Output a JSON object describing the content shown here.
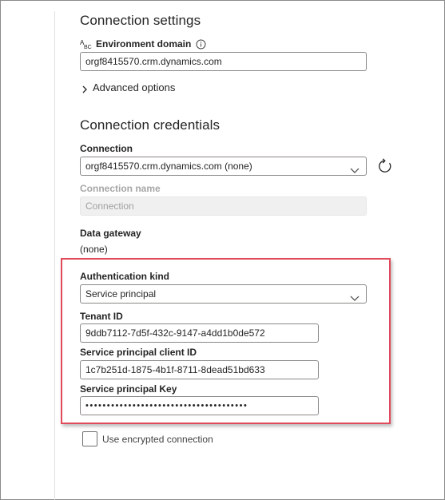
{
  "connection_settings": {
    "title": "Connection settings",
    "environment_domain_label": "Environment domain",
    "environment_domain_value": "orgf8415570.crm.dynamics.com",
    "advanced_options_label": "Advanced options"
  },
  "connection_credentials": {
    "title": "Connection credentials",
    "connection_label": "Connection",
    "connection_value": "orgf8415570.crm.dynamics.com (none)",
    "connection_name_label": "Connection name",
    "connection_name_placeholder": "Connection",
    "data_gateway_label": "Data gateway",
    "data_gateway_value": "(none)",
    "authentication_kind_label": "Authentication kind",
    "authentication_kind_value": "Service principal",
    "tenant_id_label": "Tenant ID",
    "tenant_id_value": "9ddb7112-7d5f-432c-9147-a4dd1b0de572",
    "client_id_label": "Service principal client ID",
    "client_id_value": "1c7b251d-1875-4b1f-8711-8dead51bd633",
    "key_label": "Service principal Key",
    "key_value": "••••••••••••••••••••••••••••••••••••••",
    "use_encrypted_label": "Use encrypted connection",
    "use_encrypted_checked": false
  },
  "icons": {
    "text_type_icon": "ABC-text-icon",
    "info_icon": "info-icon",
    "refresh_icon": "refresh-icon",
    "chevron_right_icon": "chevron-right-icon",
    "chevron_down_icon": "chevron-down-icon"
  },
  "colors": {
    "highlight_border": "#e04a5a",
    "input_border": "#8a8886",
    "disabled_bg": "#f0f0f0"
  }
}
